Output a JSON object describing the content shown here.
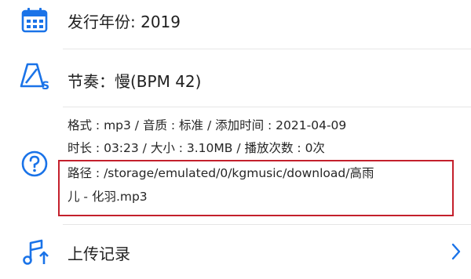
{
  "release": {
    "label": "发行年份: 2019",
    "icon": "calendar-icon"
  },
  "tempo": {
    "label": "节奏：慢(BPM 42)",
    "icon": "metronome-icon"
  },
  "info": {
    "line1": "格式 : mp3 / 音质 : 标准 / 添加时间 : 2021-04-09",
    "line2": "时长 : 03:23 / 大小 : 3.10MB / 播放次数 : 0次",
    "path_line1": "路径 : /storage/emulated/0/kgmusic/download/高雨",
    "path_line2": "儿 - 化羽.mp3",
    "icon": "help-icon"
  },
  "upload": {
    "label": "上传记录",
    "icon": "music-upload-icon",
    "chevron": "chevron-right-icon"
  },
  "colors": {
    "accent": "#1a73e8",
    "highlight_border": "#c4202c",
    "divider": "#e6e6e6"
  }
}
